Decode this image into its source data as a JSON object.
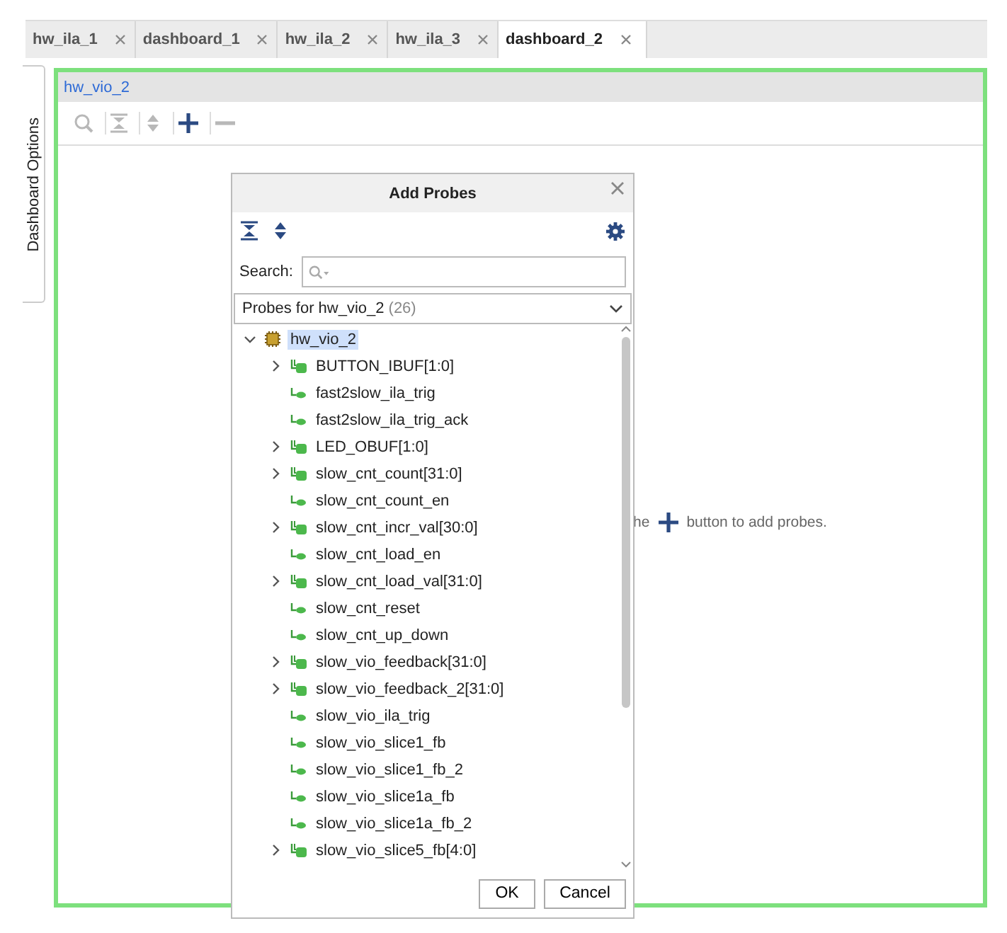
{
  "tabs": [
    {
      "label": "hw_ila_1",
      "selected": false
    },
    {
      "label": "dashboard_1",
      "selected": false
    },
    {
      "label": "hw_ila_2",
      "selected": false
    },
    {
      "label": "hw_ila_3",
      "selected": false
    },
    {
      "label": "dashboard_2",
      "selected": true
    }
  ],
  "side_tab": {
    "label": "Dashboard Options"
  },
  "panel": {
    "title": "hw_vio_2",
    "toolbar": [
      {
        "kind": "search",
        "disabled": true
      },
      {
        "kind": "collapse",
        "disabled": true
      },
      {
        "kind": "expand",
        "disabled": true
      },
      {
        "kind": "add",
        "disabled": false
      },
      {
        "kind": "remove",
        "disabled": true
      }
    ],
    "hint_start": "he",
    "hint_end": "button to add probes."
  },
  "dialog": {
    "title": "Add Probes",
    "search_label": "Search:",
    "probe_set": {
      "label": "Probes for hw_vio_2",
      "count": "(26)"
    },
    "tree": {
      "label": "hw_vio_2",
      "expanded": true,
      "selected": true,
      "children": [
        {
          "label": "BUTTON_IBUF[1:0]",
          "kind": "bus",
          "expanded": false,
          "selected": false
        },
        {
          "label": "fast2slow_ila_trig",
          "kind": "signal",
          "selected": false
        },
        {
          "label": "fast2slow_ila_trig_ack",
          "kind": "signal",
          "selected": false
        },
        {
          "label": "LED_OBUF[1:0]",
          "kind": "bus",
          "expanded": false,
          "selected": false
        },
        {
          "label": "slow_cnt_count[31:0]",
          "kind": "bus",
          "expanded": false,
          "selected": false
        },
        {
          "label": "slow_cnt_count_en",
          "kind": "signal",
          "selected": false
        },
        {
          "label": "slow_cnt_incr_val[30:0]",
          "kind": "bus",
          "expanded": false,
          "selected": false
        },
        {
          "label": "slow_cnt_load_en",
          "kind": "signal",
          "selected": false
        },
        {
          "label": "slow_cnt_load_val[31:0]",
          "kind": "bus",
          "expanded": false,
          "selected": false
        },
        {
          "label": "slow_cnt_reset",
          "kind": "signal",
          "selected": false
        },
        {
          "label": "slow_cnt_up_down",
          "kind": "signal",
          "selected": false
        },
        {
          "label": "slow_vio_feedback[31:0]",
          "kind": "bus",
          "expanded": false,
          "selected": false
        },
        {
          "label": "slow_vio_feedback_2[31:0]",
          "kind": "bus",
          "expanded": false,
          "selected": false
        },
        {
          "label": "slow_vio_ila_trig",
          "kind": "signal",
          "selected": false
        },
        {
          "label": "slow_vio_slice1_fb",
          "kind": "signal",
          "selected": false
        },
        {
          "label": "slow_vio_slice1_fb_2",
          "kind": "signal",
          "selected": false
        },
        {
          "label": "slow_vio_slice1a_fb",
          "kind": "signal",
          "selected": false
        },
        {
          "label": "slow_vio_slice1a_fb_2",
          "kind": "signal",
          "selected": false
        },
        {
          "label": "slow_vio_slice5_fb[4:0]",
          "kind": "bus",
          "expanded": false,
          "selected": false
        }
      ]
    },
    "buttons": [
      "OK",
      "Cancel"
    ]
  }
}
